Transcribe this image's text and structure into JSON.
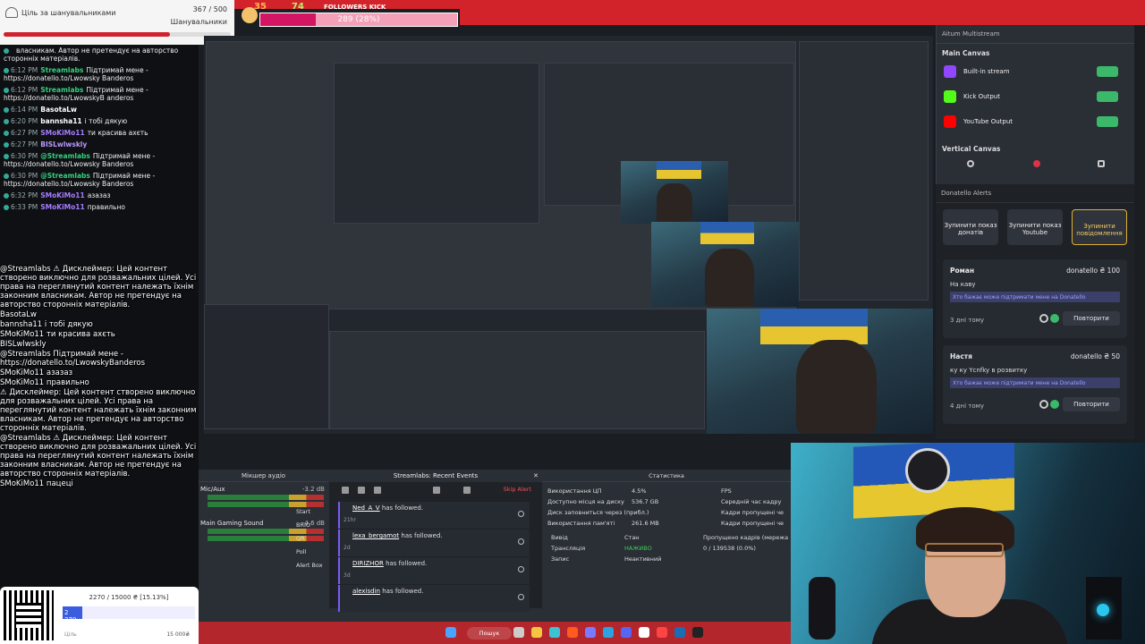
{
  "goal_widget": {
    "title": "Ціль за шанувальниками",
    "count": "367 / 500",
    "subtitle": "Шанувальники",
    "progress": 0.734
  },
  "followers_kick": {
    "count_left": "35",
    "count_right": "74",
    "title": "FOLLOWERS KICK",
    "bar_text": "289 (28%)",
    "progress": 0.28
  },
  "chat": [
    {
      "time": "",
      "user": "",
      "text": "власникам. Автор не претендує на авторство сторонніх матеріалів.",
      "cls": "u-bn"
    },
    {
      "time": "6:12 PM",
      "user": "Streamlabs",
      "text": "Підтримай мене - https://donatello.to/Lwowsky Banderos",
      "cls": "u-sl"
    },
    {
      "time": "6:12 PM",
      "user": "Streamlabs",
      "text": "Підтримай мене - https://donatello.to/LwowskyB anderos",
      "cls": "u-sl"
    },
    {
      "time": "6:14 PM",
      "user": "BasotaLw",
      "text": "",
      "cls": "u-bn"
    },
    {
      "time": "6:20 PM",
      "user": "bannsha11",
      "text": "і тобі дякую",
      "cls": "u-bn"
    },
    {
      "time": "6:27 PM",
      "user": "SMoKiMo11",
      "text": "ти красива ахєть",
      "cls": "u-sm"
    },
    {
      "time": "6:27 PM",
      "user": "BISLwlwskly",
      "text": "",
      "cls": "u-bs"
    },
    {
      "time": "6:30 PM",
      "user": "@Streamlabs",
      "text": "Підтримай мене - https://donatello.to/Lwowsky Banderos",
      "cls": "u-sl"
    },
    {
      "time": "6:30 PM",
      "user": "@Streamlabs",
      "text": "Підтримай мене - https://donatello.to/Lwowsky Banderos",
      "cls": "u-sl"
    },
    {
      "time": "6:32 PM",
      "user": "SMoKiMo11",
      "text": "азазаз",
      "cls": "u-sm"
    },
    {
      "time": "6:33 PM",
      "user": "SMoKiMo11",
      "text": "правильно",
      "cls": "u-sm"
    }
  ],
  "bigchat": [
    "@Streamlabs ⚠ Дисклеймер: Цей контент створено виключно для розважальних цілей. Усі права на переглянутий контент належать їхнім законним власникам. Автор не претендує на авторство сторонніх матеріалів.",
    "BasotaLw",
    "bannsha11 і тобі дякую",
    "SMoKiMo11 ти красива ахєть",
    "BISLwlwskly",
    "@Streamlabs Підтримай мене - https://donatello.to/LwowskyBanderos",
    "SMoKiMo11 азазаз",
    "SMoKiMo11 правильно",
    "⚠ Дисклеймер: Цей контент створено виключно для розважальних цілей. Усі права на переглянутий контент належать їхнім законним власникам. Автор не претендує на авторство сторонніх матеріалів.",
    "@Streamlabs ⚠ Дисклеймер: Цей контент створено виключно для розважальних цілей. Усі права на переглянутий контент належать їхнім законним власникам. Автор не претендує на авторство сторонніх матеріалів.",
    "SMoKiMo11 пацеці"
  ],
  "qr_goal": {
    "amount": "2270 / 15000 ₴ [15.13%]",
    "fill_label": "2 270",
    "progress": 0.1513,
    "label_left": "Ціль",
    "label_right": "15 000₴"
  },
  "multistream": {
    "header": "Aitum Multistream",
    "main_canvas": "Main Canvas",
    "outputs": [
      {
        "name": "Built-in stream",
        "color": "#9146ff"
      },
      {
        "name": "Kick Output",
        "color": "#53fc18"
      },
      {
        "name": "YouTube Output",
        "color": "#ff0000"
      }
    ],
    "vertical_canvas": "Vertical Canvas"
  },
  "donatello": {
    "header": "Donatello Alerts",
    "buttons": [
      "Зупинити показ донатів",
      "Зупинити показ Youtube",
      "Зупинити повідомлення"
    ],
    "cards": [
      {
        "name": "Роман",
        "source": "donatello ₴ 100",
        "message": "На каву",
        "box": "Хто бажає може підтримати мене на Donatello",
        "when": "3 дні тому",
        "repeat": "Повторити"
      },
      {
        "name": "Настя",
        "source": "donatello ₴ 50",
        "message": "ку ку Ycnfky в розвитку",
        "box": "Хто бажає може підтримати мене на Donatello",
        "when": "4 дні тому",
        "repeat": "Повторити"
      }
    ]
  },
  "mixer": {
    "title": "Мікшер аудіо",
    "channels": [
      {
        "name": "Mic/Aux",
        "db": "-3.2 dB"
      },
      {
        "name": "Main Gaming Sound",
        "db": "-4.6 dB"
      }
    ],
    "sources": [
      "Start",
      "BRIO",
      "QR",
      "Poll",
      "Alert Box"
    ]
  },
  "recent_events": {
    "title": "Streamlabs: Recent Events",
    "skip": "Skip Alert",
    "events": [
      {
        "user": "Ned_A_V",
        "text": "has followed.",
        "ago": "21hr"
      },
      {
        "user": "lexa_bergamot",
        "text": "has followed.",
        "ago": "2d"
      },
      {
        "user": "DIRIZHOR",
        "text": "has followed.",
        "ago": "3d"
      },
      {
        "user": "alexisdin",
        "text": "has followed.",
        "ago": ""
      }
    ]
  },
  "stats": {
    "title": "Статистика",
    "rows": [
      {
        "k": "Використання ЦП",
        "v": "4.5%",
        "k2": "FPS",
        "v2": ""
      },
      {
        "k": "Доступно місця на диску",
        "v": "536.7 GB",
        "k2": "Середній час кадру",
        "v2": ""
      },
      {
        "k": "Диск заповниться через (прибл.)",
        "v": "",
        "k2": "Кадри пропущені че",
        "v2": ""
      },
      {
        "k": "Використання пам'яті",
        "v": "261.6 MB",
        "k2": "Кадри пропущені че",
        "v2": ""
      }
    ],
    "table_headers": [
      "Вивід",
      "Стан",
      "Пропущено кадрів (мережа"
    ],
    "table_rows": [
      {
        "out": "Трансляція",
        "state": "НАЖИВО",
        "drop": "0 / 139538 (0.0%)"
      },
      {
        "out": "Запис",
        "state": "Неактивний",
        "drop": ""
      }
    ]
  },
  "taskbar": {
    "search": "Пошук"
  }
}
